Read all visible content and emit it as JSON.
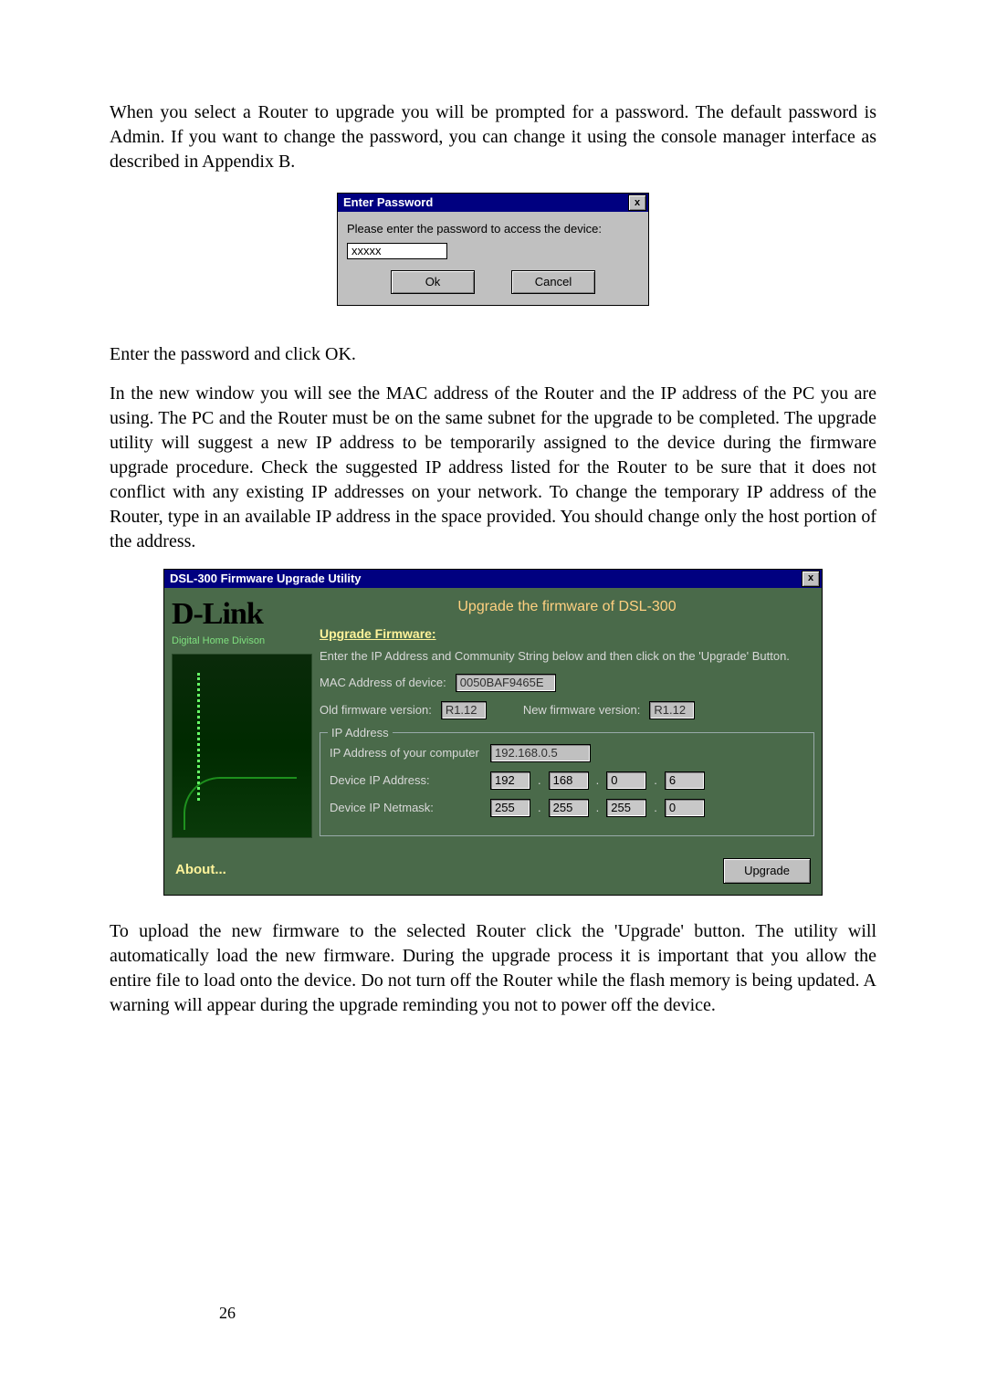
{
  "paragraphs": {
    "intro": "When you select a Router to upgrade you will be prompted for a password. The default password is Admin. If you want to change the password, you can change it using the console manager interface as described in Appendix B.",
    "after_pwd_1": "Enter the password and click OK.",
    "after_pwd_2": "In the new window you will see the MAC address of the Router and the IP address of the PC you are using. The PC and the Router must be on the same subnet for the upgrade to be completed. The upgrade utility will suggest a new IP address to be temporarily assigned to the device during the firmware upgrade procedure. Check the suggested IP address listed for the Router to be sure that it does not conflict with any existing IP addresses on your network. To change the temporary IP address of the Router, type in an available IP address in the space provided. You should change only the host portion of the address.",
    "after_fw": "To upload the new firmware to the selected Router click the 'Upgrade' button. The utility will automatically load the new firmware. During the upgrade process it is important that you allow the entire file to load onto the device. Do not turn off the Router while the flash memory is being updated. A warning will appear during the upgrade reminding you not to power off the device."
  },
  "password_dialog": {
    "title": "Enter Password",
    "close_glyph": "x",
    "prompt": "Please enter the password to access the device:",
    "value": "xxxxx",
    "ok_label": "Ok",
    "cancel_label": "Cancel"
  },
  "fw_dialog": {
    "title": "DSL-300 Firmware Upgrade Utility",
    "close_glyph": "x",
    "brand": "D-Link",
    "brand_tag": "Digital  Home  Divison",
    "banner": "Upgrade the firmware of DSL-300",
    "section_title": "Upgrade Firmware:",
    "instruction": "Enter the IP Address and  Community String below and then click on the 'Upgrade' Button.",
    "mac_label": "MAC Address of device:",
    "mac_value": "0050BAF9465E",
    "old_fw_label": "Old firmware version:",
    "old_fw_value": "R1.12",
    "new_fw_label": "New firmware version:",
    "new_fw_value": "R1.12",
    "ip_fieldset_title": "IP Address",
    "ip_pc_label": "IP Address of your  computer",
    "ip_pc_value": "192.168.0.5",
    "dev_ip_label": "Device IP Address:",
    "dev_ip_octets": [
      "192",
      "168",
      "0",
      "6"
    ],
    "dev_mask_label": "Device IP Netmask:",
    "dev_mask_octets": [
      "255",
      "255",
      "255",
      "0"
    ],
    "about_label": "About...",
    "upgrade_label": "Upgrade"
  },
  "page_number": "26"
}
